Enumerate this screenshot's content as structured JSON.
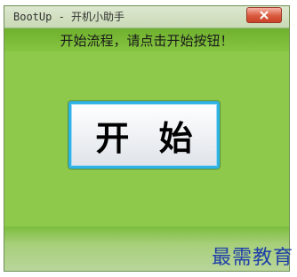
{
  "window": {
    "title": "BootUp - 开机小助手"
  },
  "banner": {
    "text": "开始流程，请点击开始按钮！"
  },
  "main": {
    "start_label": "开 始"
  },
  "watermark": {
    "text": "最需教育"
  },
  "icons": {
    "close": "close-icon"
  },
  "colors": {
    "window_bg": "#8fc94c",
    "banner_bg": "#6fb02e",
    "button_border": "#2fb3e6",
    "close_button": "#d85a3d",
    "watermark": "#1f3fa8"
  }
}
